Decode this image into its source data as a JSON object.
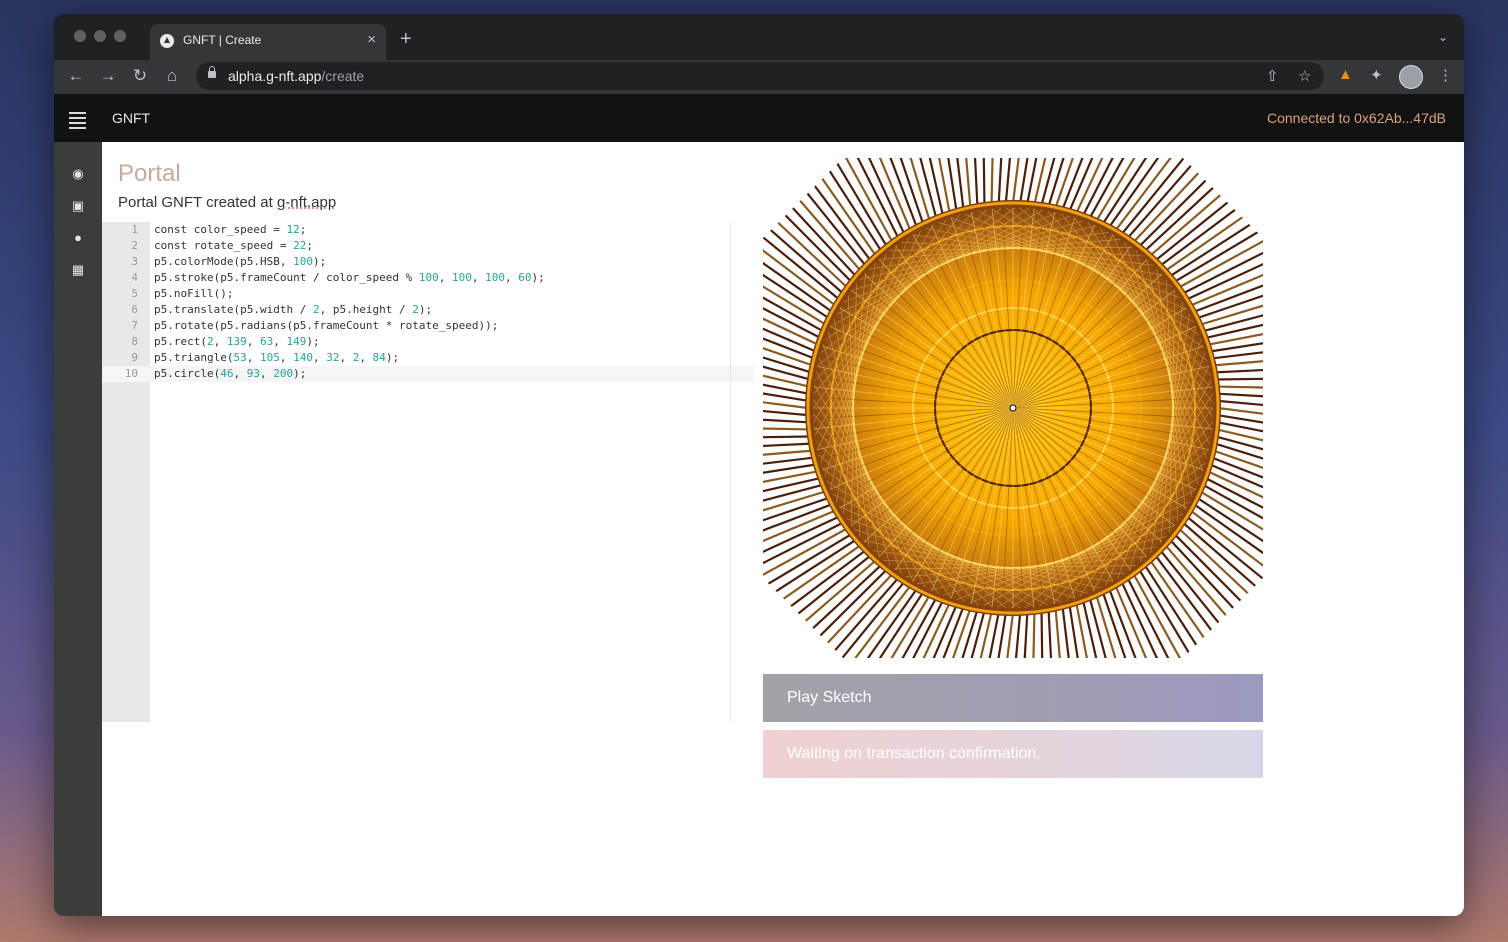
{
  "browser": {
    "tab_title": "GNFT | Create",
    "tab_close": "×",
    "new_tab": "+",
    "url_host": "alpha.g-nft.app",
    "url_path": "/create"
  },
  "app": {
    "brand": "GNFT",
    "connected": "Connected to 0x62Ab...47dB"
  },
  "sidebar": {
    "icons": [
      "palette-icon",
      "toolbox-icon",
      "community-icon",
      "network-icon"
    ]
  },
  "page": {
    "title": "Portal",
    "subtitle_prefix": "Portal GNFT created at ",
    "subtitle_link": "g-nft.app"
  },
  "editor": {
    "active_line": 10,
    "lines": [
      {
        "n": "1",
        "tokens": [
          [
            "const color_speed = ",
            ""
          ],
          [
            "12",
            "num"
          ],
          [
            ";",
            ""
          ]
        ]
      },
      {
        "n": "2",
        "tokens": [
          [
            "const rotate_speed = ",
            ""
          ],
          [
            "22",
            "num"
          ],
          [
            ";",
            ""
          ]
        ]
      },
      {
        "n": "3",
        "tokens": [
          [
            "p5.colorMode(p5.HSB, ",
            ""
          ],
          [
            "100",
            "num"
          ],
          [
            ");",
            ""
          ]
        ]
      },
      {
        "n": "4",
        "tokens": [
          [
            "p5.stroke(p5.frameCount / color_speed % ",
            ""
          ],
          [
            "100",
            "num"
          ],
          [
            ", ",
            ""
          ],
          [
            "100",
            "num"
          ],
          [
            ", ",
            ""
          ],
          [
            "100",
            "num"
          ],
          [
            ", ",
            ""
          ],
          [
            "60",
            "num"
          ],
          [
            ");",
            ""
          ]
        ]
      },
      {
        "n": "5",
        "tokens": [
          [
            "p5.noFill();",
            ""
          ]
        ]
      },
      {
        "n": "6",
        "tokens": [
          [
            "p5.translate(p5.width / ",
            ""
          ],
          [
            "2",
            "num"
          ],
          [
            ", p5.height / ",
            ""
          ],
          [
            "2",
            "num"
          ],
          [
            ");",
            ""
          ]
        ]
      },
      {
        "n": "7",
        "tokens": [
          [
            "p5.rotate(p5.radians(p5.frameCount * rotate_speed));",
            ""
          ]
        ]
      },
      {
        "n": "8",
        "tokens": [
          [
            "p5.rect(",
            ""
          ],
          [
            "2",
            "num"
          ],
          [
            ", ",
            ""
          ],
          [
            "139",
            "num"
          ],
          [
            ", ",
            ""
          ],
          [
            "63",
            "num"
          ],
          [
            ", ",
            ""
          ],
          [
            "149",
            "num"
          ],
          [
            ");",
            ""
          ]
        ]
      },
      {
        "n": "9",
        "tokens": [
          [
            "p5.triangle(",
            ""
          ],
          [
            "53",
            "num"
          ],
          [
            ", ",
            ""
          ],
          [
            "105",
            "num"
          ],
          [
            ", ",
            ""
          ],
          [
            "140",
            "num"
          ],
          [
            ", ",
            ""
          ],
          [
            "32",
            "num"
          ],
          [
            ", ",
            ""
          ],
          [
            "2",
            "num"
          ],
          [
            ", ",
            ""
          ],
          [
            "84",
            "num"
          ],
          [
            ");",
            ""
          ]
        ]
      },
      {
        "n": "10",
        "tokens": [
          [
            "p5.circle(",
            ""
          ],
          [
            "46",
            "num"
          ],
          [
            ", ",
            ""
          ],
          [
            "93",
            "num"
          ],
          [
            ", ",
            ""
          ],
          [
            "200",
            "num"
          ],
          [
            ");",
            ""
          ]
        ]
      }
    ]
  },
  "actions": {
    "play_label": "Play Sketch",
    "status_text": "Waiting on transaction confirmation."
  },
  "colors": {
    "accent": "#d9a47c",
    "sketch_gold": "#f5a800",
    "sketch_dark": "#4a1f0a"
  }
}
